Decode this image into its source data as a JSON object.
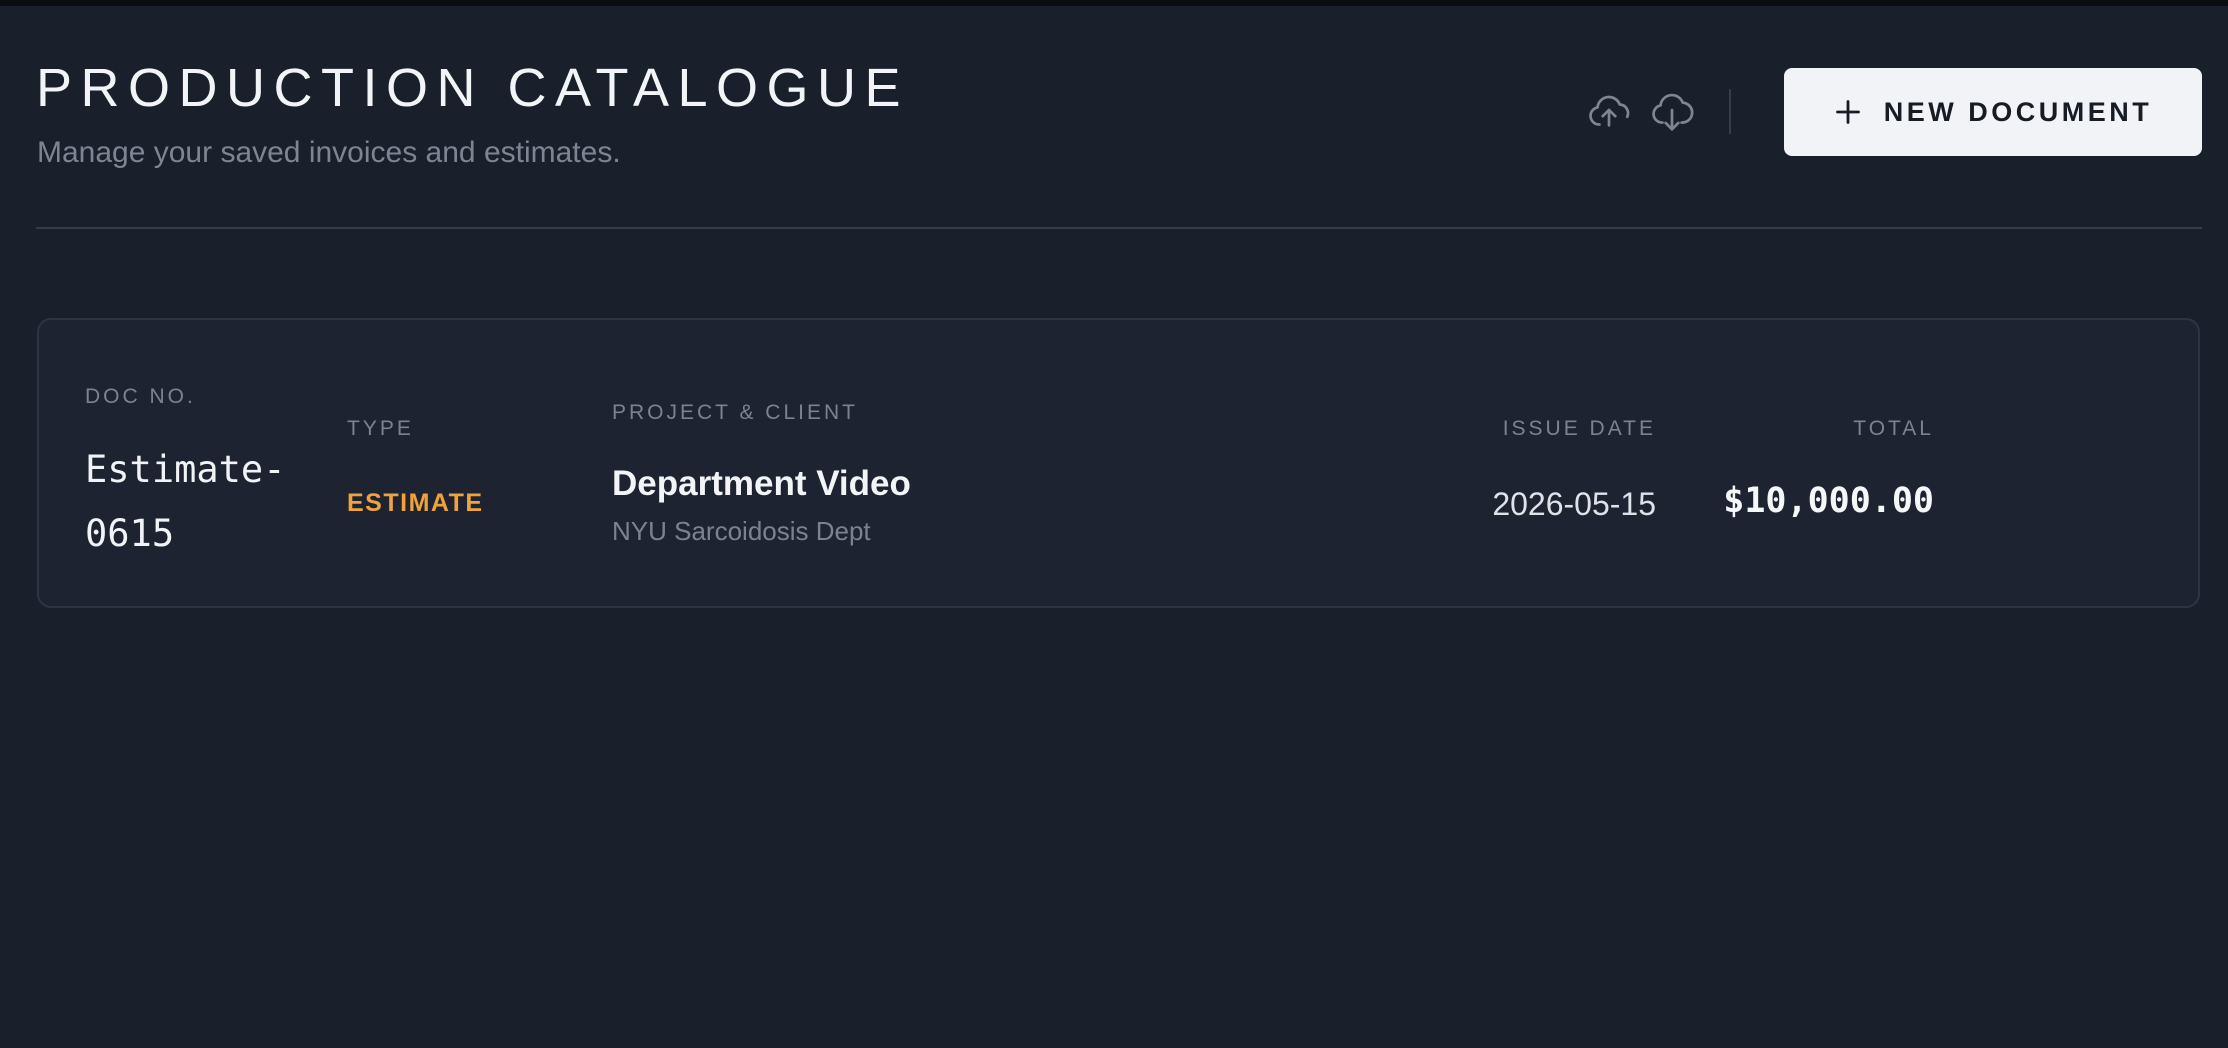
{
  "header": {
    "title": "PRODUCTION CATALOGUE",
    "subtitle": "Manage your saved invoices and estimates.",
    "upload_icon": "cloud-upload-icon",
    "download_icon": "cloud-download-icon",
    "new_button_label": "NEW DOCUMENT",
    "new_button_icon": "plus-icon"
  },
  "table": {
    "columns": {
      "doc_no": "DOC NO.",
      "type": "TYPE",
      "project_client": "PROJECT & CLIENT",
      "issue_date": "ISSUE DATE",
      "total": "TOTAL"
    },
    "rows": [
      {
        "doc_no": "Estimate-0615",
        "type": "ESTIMATE",
        "project": "Department Video",
        "client": "NYU Sarcoidosis Dept",
        "issue_date": "2026-05-15",
        "total": "$10,000.00"
      }
    ]
  },
  "colors": {
    "background": "#1a1f2c",
    "card": "#1e2331",
    "accent_estimate": "#f0a23b",
    "button_bg": "#f1f3f6"
  }
}
